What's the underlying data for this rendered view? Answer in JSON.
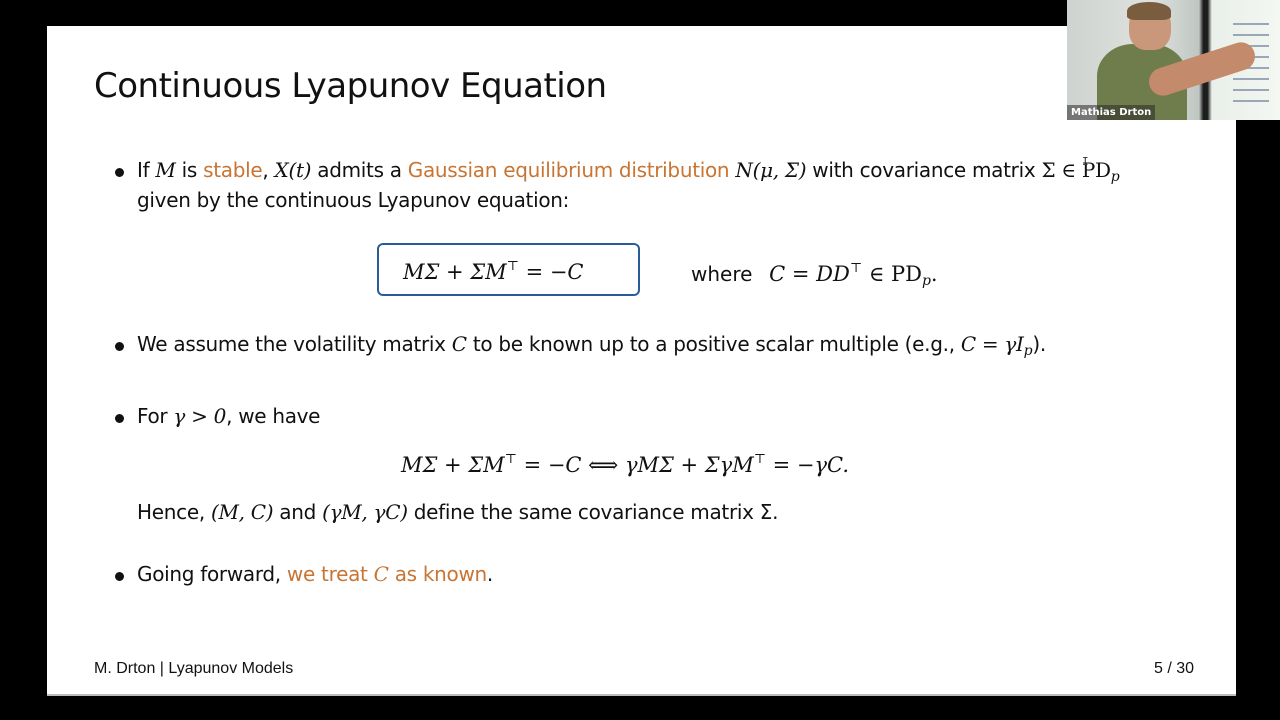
{
  "slide": {
    "title": "Continuous Lyapunov Equation",
    "bullet1": {
      "t1": "If ",
      "M": "M",
      "t2": " is ",
      "stable": "stable",
      "t3": ", ",
      "Xt": "X(t)",
      "t4": " admits a ",
      "gaussian": "Gaussian equilibrium distribution",
      "t5": " ",
      "dist": "N(μ, Σ)",
      "t6": " with covariance matrix ",
      "sigma_in": "Σ ∈ PD",
      "p": "p",
      "line2": "given by the continuous Lyapunov equation:"
    },
    "boxed_equation": {
      "lhs": "MΣ + ΣM",
      "T": "⊤",
      "rhs": " = −C"
    },
    "where_clause": {
      "word": "where",
      "eq": "C = DD",
      "T": "⊤",
      "rest": " ∈ PD",
      "p": "p",
      "end": "."
    },
    "bullet2": {
      "t1": "We assume the volatility matrix ",
      "C": "C",
      "t2": " to be known up to a positive scalar multiple (e.g., ",
      "eq": "C = γI",
      "p": "p",
      "end": ")."
    },
    "bullet3": {
      "t1": "For ",
      "cond": "γ > 0",
      "t2": ", we have",
      "eq_lhs": "MΣ + ΣM",
      "T1": "⊤",
      "eq_mid": " = −C  ⟺  γMΣ + ΣγM",
      "T2": "⊤",
      "eq_rhs": " = −γC.",
      "hence_t1": "Hence, ",
      "pair1": "(M, C)",
      "hence_t2": " and ",
      "pair2": "(γM, γC)",
      "hence_t3": " define the same covariance matrix Σ."
    },
    "bullet4": {
      "t1": "Going forward, ",
      "highlight_a": "we treat ",
      "C": "C",
      "highlight_b": " as known",
      "end": "."
    },
    "footer": {
      "left": "M. Drton | Lyapunov Models",
      "page": "5 / 30"
    }
  },
  "video": {
    "speaker_name": "Mathias Drton"
  },
  "colors": {
    "highlight": "#c87533",
    "box_border": "#2b5c9a"
  }
}
